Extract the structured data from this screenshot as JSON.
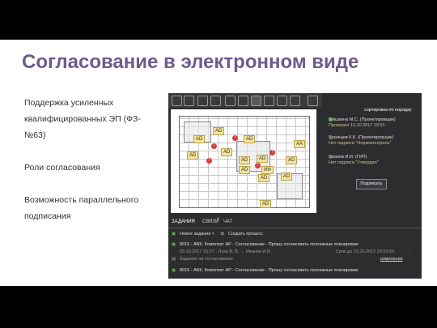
{
  "title": "Согласование в электронном виде",
  "bullets": [
    "Поддержка усиленных квалифицированных ЭП (ФЗ-№63)",
    "Роли согласования",
    "Возможность параллельного подписания"
  ],
  "app": {
    "sort_label": "сортировка по порядку",
    "signers": [
      {
        "name": "Шишкина М.С. (Проектировщик)",
        "status": "Проверил 13.10.2017 10:01"
      },
      {
        "name": "Кузнецов К.К. (Проектировщик)",
        "status": "Нет подписи \"Нормоконтроль\""
      },
      {
        "name": "Иванов И.И. (ГИП)",
        "status": "Нет подписи \"Утвердил\""
      }
    ],
    "sign_button": "Подписать",
    "tabs": {
      "tasks": "ЗАДАНИЯ",
      "links": "СВЯЗИ",
      "links_count": "4",
      "chat": "ЧАТ"
    },
    "toolbar2": {
      "new_task": "Новое задание",
      "create_process": "Создать процесс"
    },
    "task1": {
      "title": "8015 - АБК. Комплект АР - Согласование - Прошу согласовать поэтажные планировки",
      "meta": "03.10.2017 15:27 - Лоза В. В. → Иванов И.И.",
      "deadline": "Срок до 23.10.2017 23:59:59",
      "sub": "Задание на согласование",
      "change": "изменения"
    },
    "task2": {
      "title": "8015 - АБК. Комплект АР - Согласование - Прошу согласовать поэтажные планировки"
    },
    "markers": {
      "ad": "AD",
      "aa": "AA",
      "ii": "ИИ"
    },
    "colors": {
      "title": "#6b5b8e",
      "panel": "#2d2d30",
      "marker": "#f4e39a",
      "pin": "#d43b3b"
    }
  }
}
